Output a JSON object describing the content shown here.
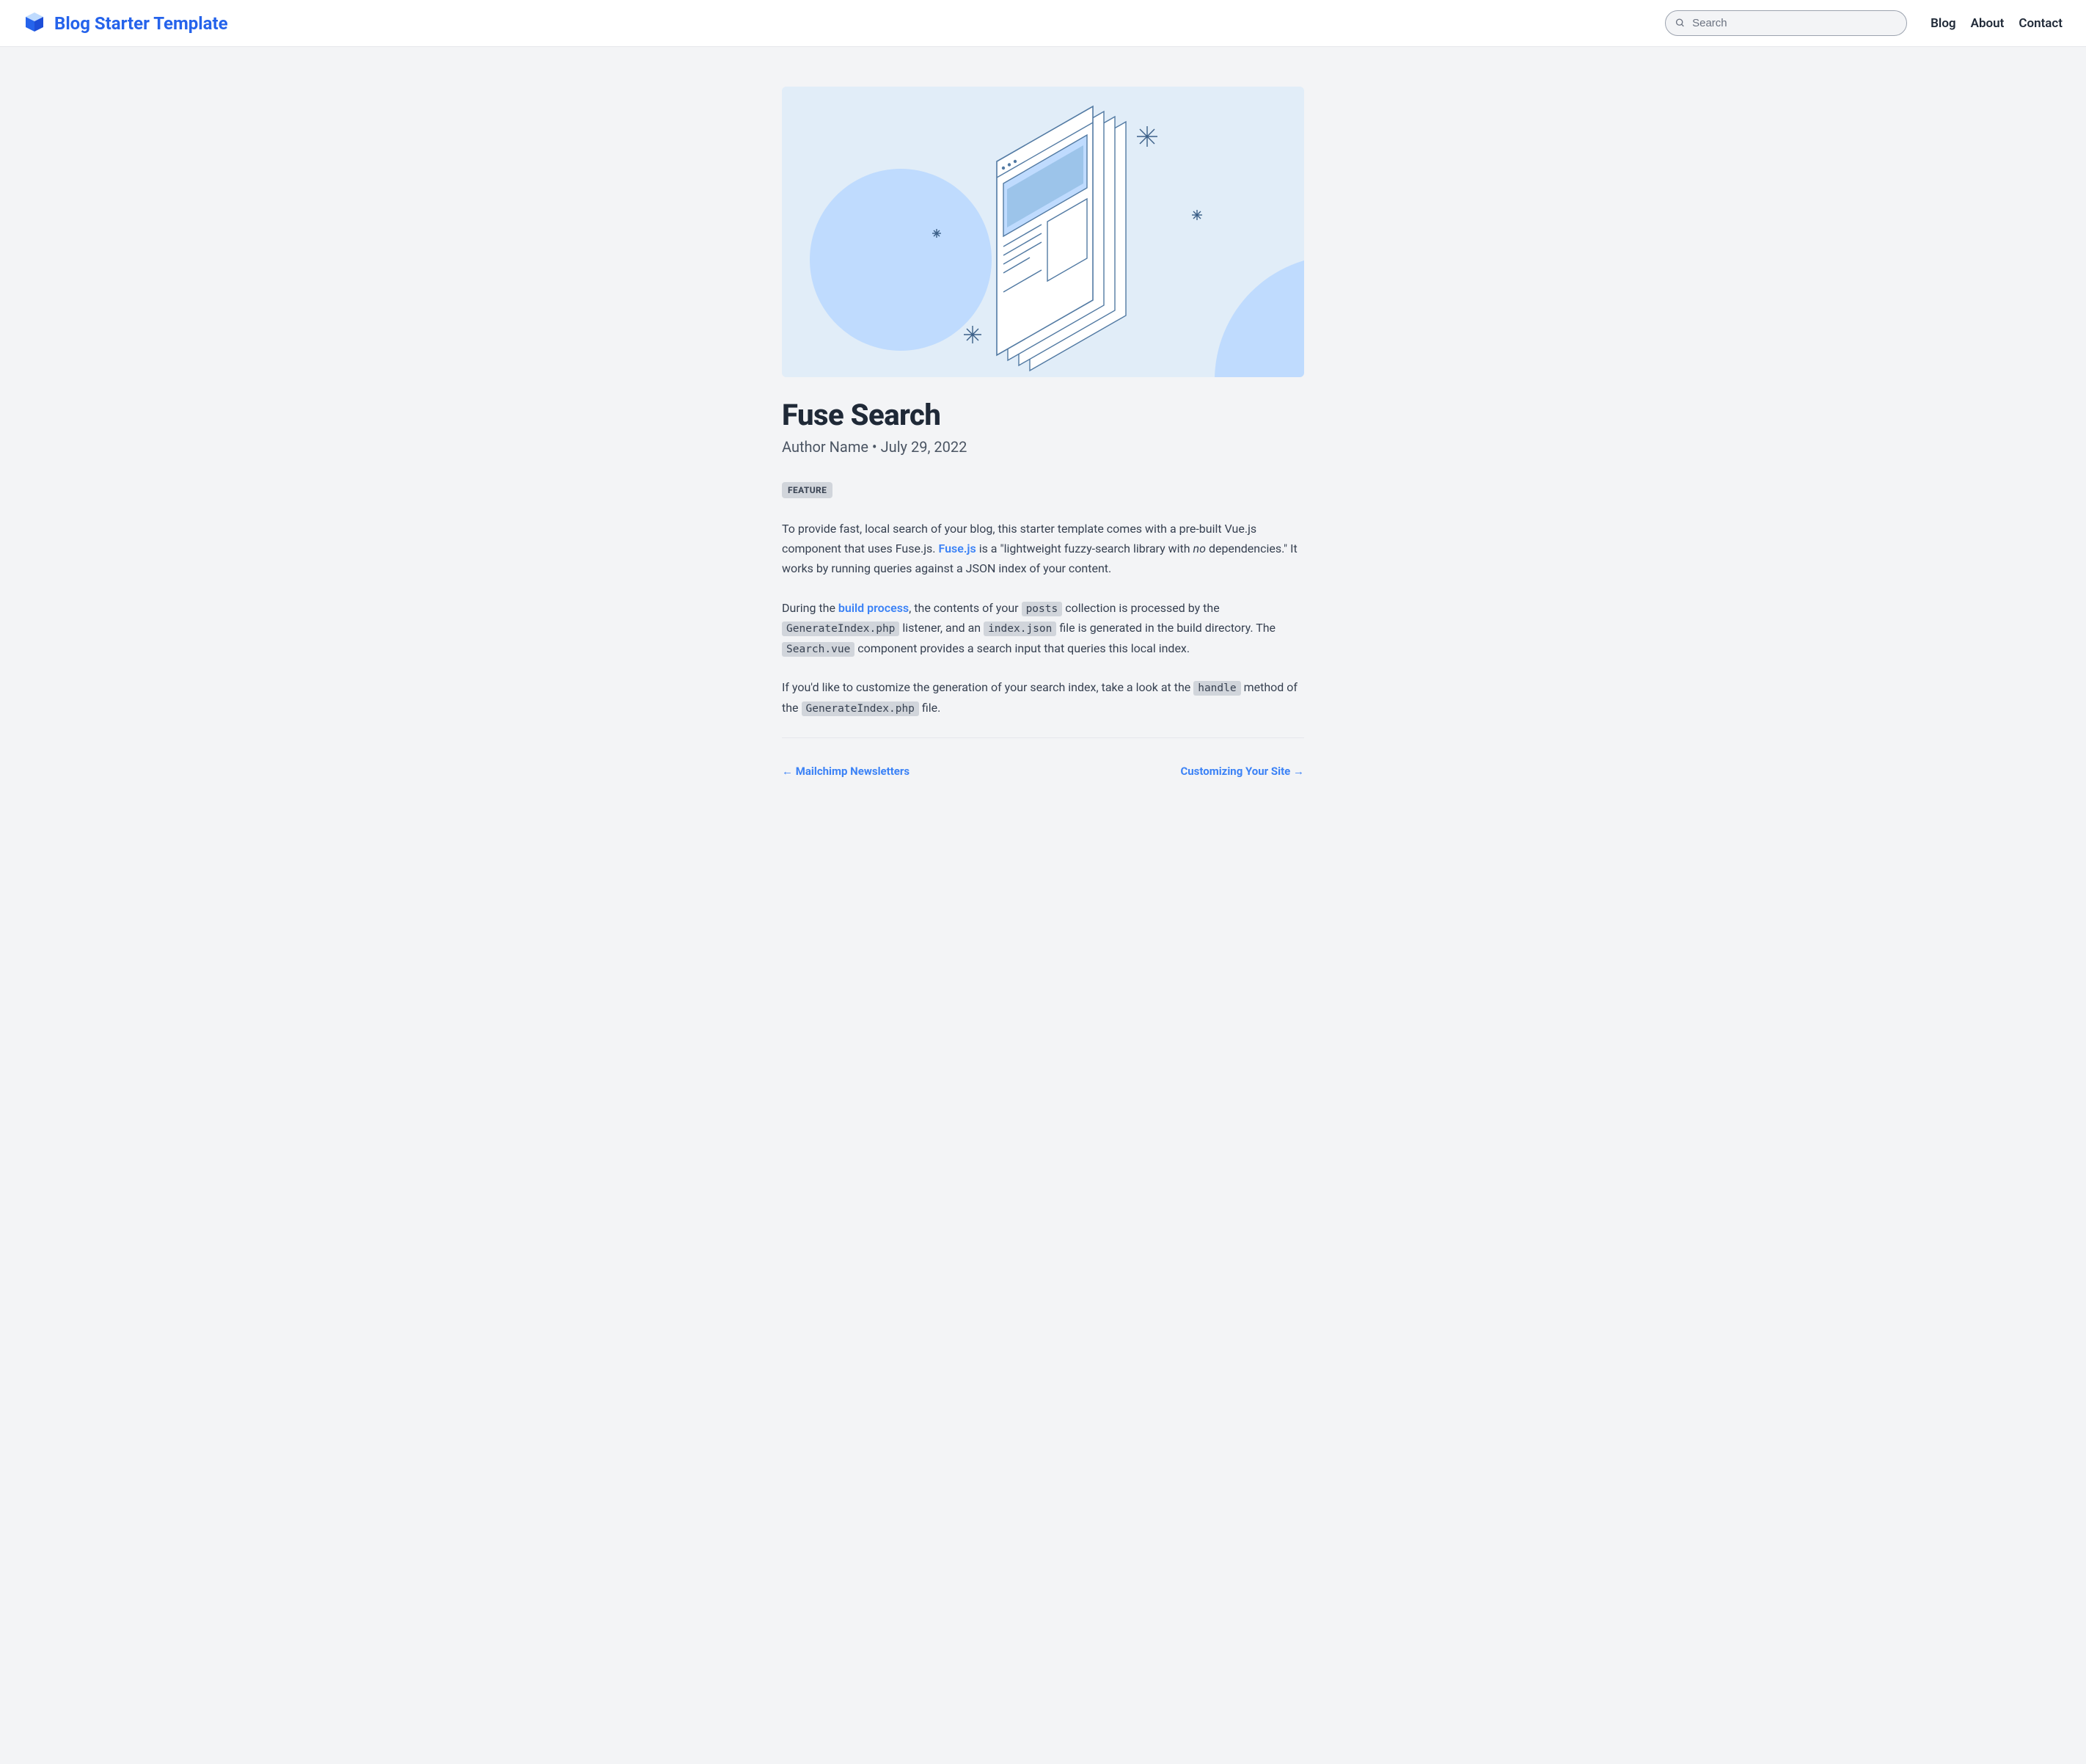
{
  "header": {
    "brand_title": "Blog Starter Template",
    "search_placeholder": "Search",
    "nav": [
      {
        "label": "Blog"
      },
      {
        "label": "About"
      },
      {
        "label": "Contact"
      }
    ]
  },
  "post": {
    "title": "Fuse Search",
    "meta": "Author Name • July 29, 2022",
    "tag": "FEATURE",
    "p1_a": "To provide fast, local search of your blog, this starter template comes with a pre-built Vue.js component that uses Fuse.js. ",
    "p1_link": "Fuse.js",
    "p1_b": " is a \"lightweight fuzzy-search library with ",
    "p1_em": "no",
    "p1_c": " dependencies.\" It works by running queries against a JSON index of your content.",
    "p2_a": "During the ",
    "p2_link": "build process",
    "p2_b": ", the contents of your ",
    "p2_code1": "posts",
    "p2_c": " collection is processed by the ",
    "p2_code2": "GenerateIndex.php",
    "p2_d": " listener, and an ",
    "p2_code3": "index.json",
    "p2_e": " file is generated in the build directory. The ",
    "p2_code4": "Search.vue",
    "p2_f": " component provides a search input that queries this local index.",
    "p3_a": "If you'd like to customize the generation of your search index, take a look at the ",
    "p3_code1": "handle",
    "p3_b": " method of the ",
    "p3_code2": "GenerateIndex.php",
    "p3_c": " file."
  },
  "postnav": {
    "prev": "← Mailchimp Newsletters",
    "next": "Customizing Your Site →"
  }
}
